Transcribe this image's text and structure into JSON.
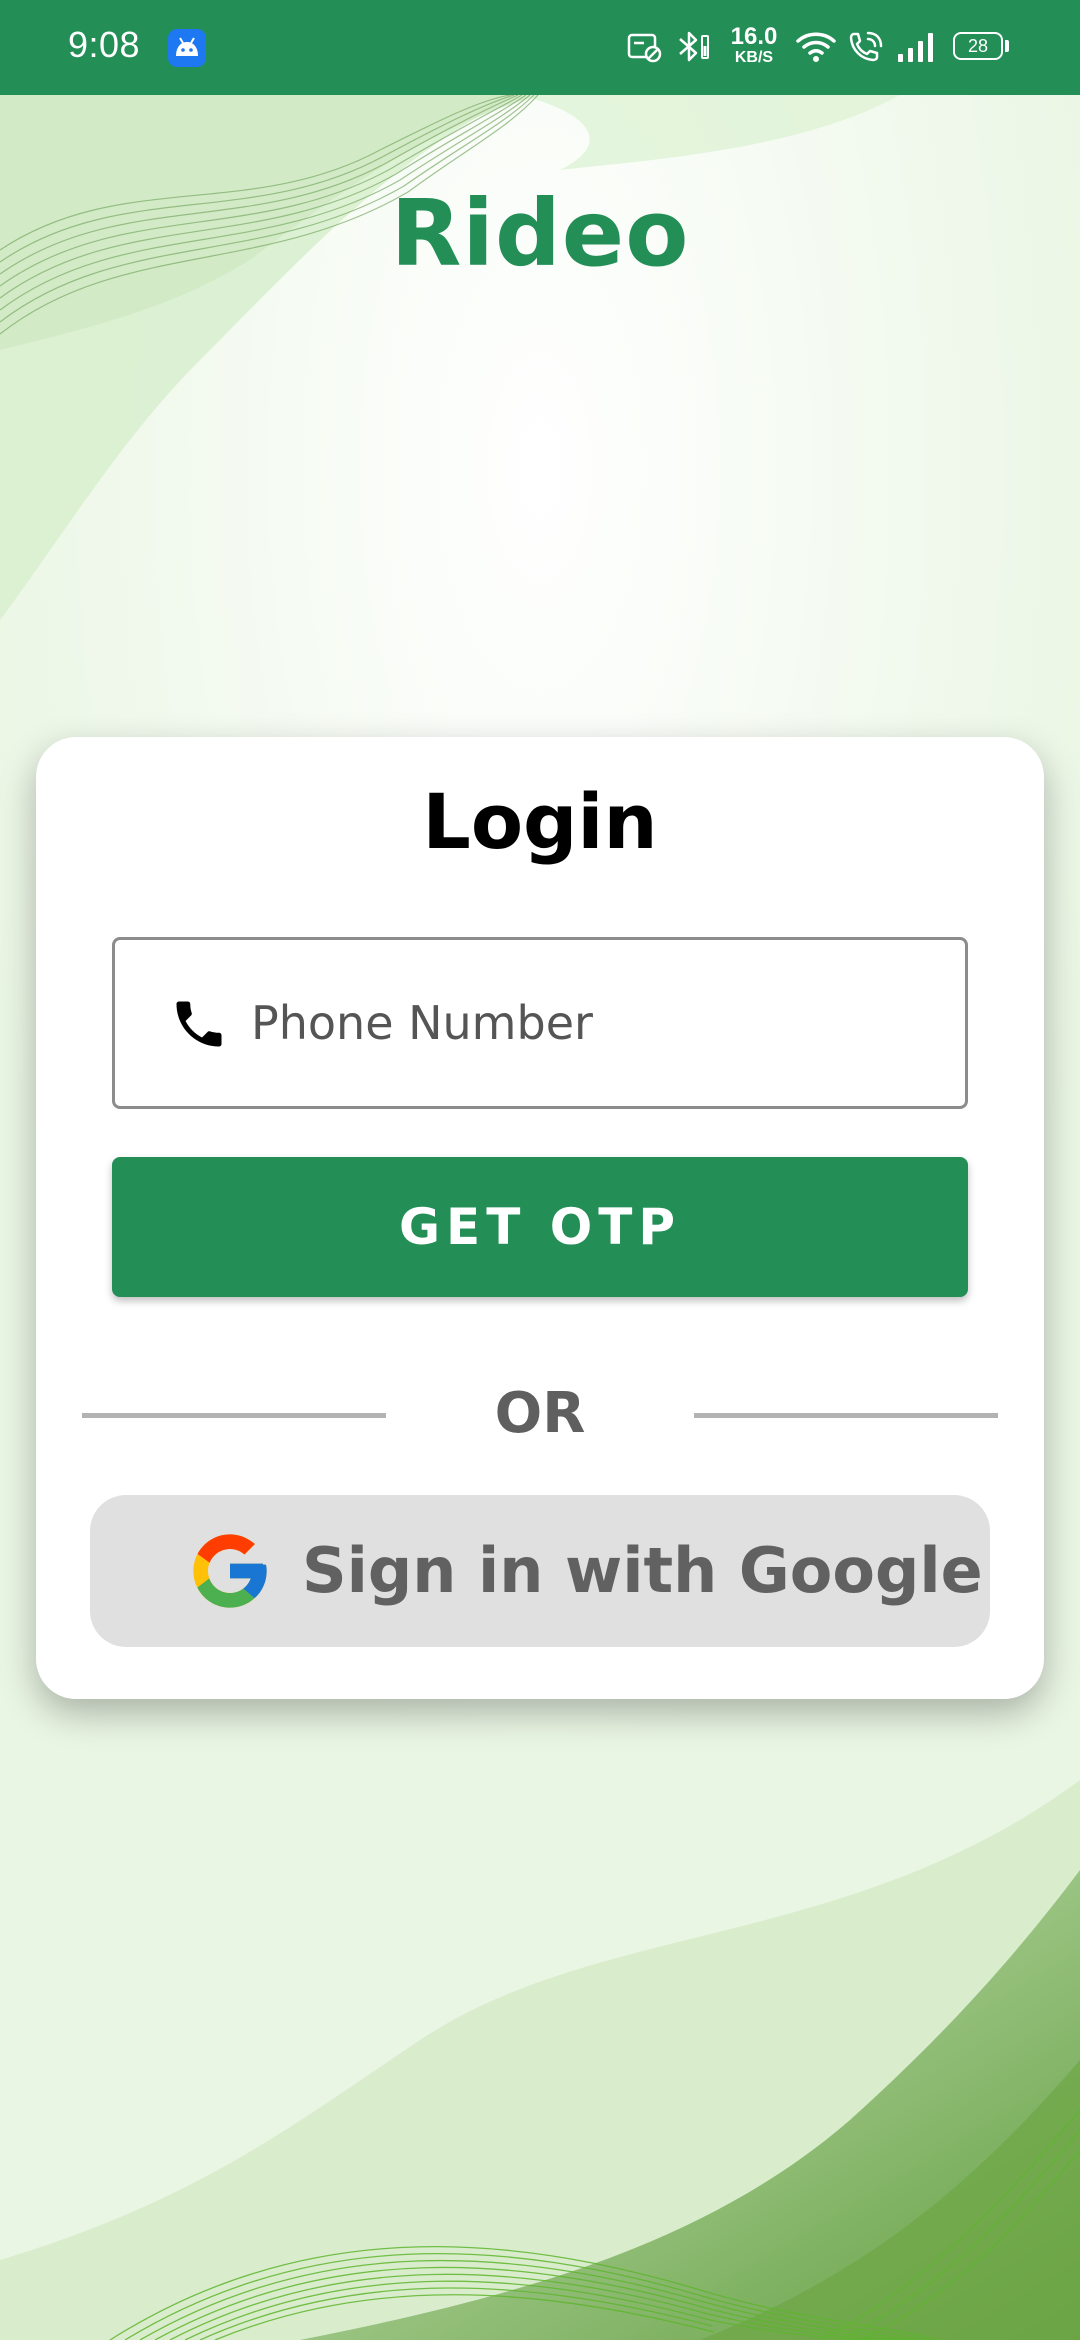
{
  "status_bar": {
    "time": "9:08",
    "speed_value": "16.0",
    "speed_unit": "KB/S",
    "battery": "28",
    "icons": [
      "android-app-icon",
      "no-sim-icon",
      "bluetooth-icon",
      "wifi-icon",
      "wifi-calling-icon",
      "signal-icon",
      "battery-icon"
    ]
  },
  "app": {
    "title": "Rideo",
    "brand_color": "#238f57"
  },
  "login": {
    "title": "Login",
    "phone_placeholder": "Phone Number",
    "phone_value": "",
    "otp_button": "GET OTP",
    "or_text": "OR",
    "google_button": "Sign in with Google"
  }
}
